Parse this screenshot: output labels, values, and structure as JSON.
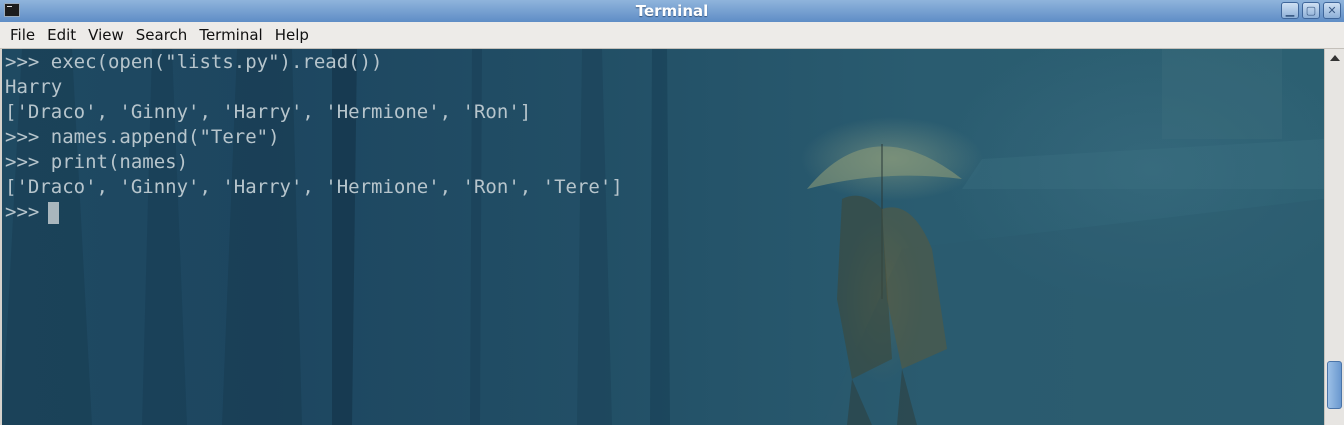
{
  "window": {
    "title": "Terminal"
  },
  "menu": [
    "File",
    "Edit",
    "View",
    "Search",
    "Terminal",
    "Help"
  ],
  "terminal": {
    "lines": [
      ">>> exec(open(\"lists.py\").read())",
      "Harry",
      "['Draco', 'Ginny', 'Harry', 'Hermione', 'Ron']",
      ">>> names.append(\"Tere\")",
      ">>> print(names)",
      "['Draco', 'Ginny', 'Harry', 'Hermione', 'Ron', 'Tere']",
      ">>> "
    ]
  },
  "colors": {
    "terminal_text": "#b7c5cc",
    "titlebar": "#6d98cc",
    "menubar": "#edebe8"
  },
  "icons": {
    "app": "terminal-icon",
    "minimize": "minimize-icon",
    "maximize": "maximize-icon",
    "close": "close-icon",
    "scroll_up": "arrow-up-icon"
  },
  "scroll": {
    "position_fraction": 0.95
  }
}
